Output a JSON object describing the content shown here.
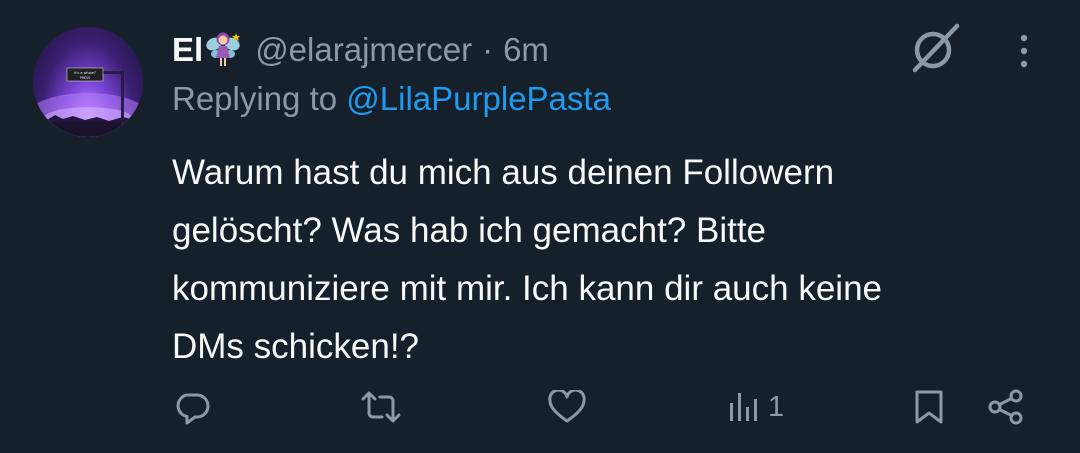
{
  "tweet": {
    "display_name": "El",
    "name_emoji": "fairy-emoji",
    "handle": "@elarajmercer",
    "separator": "·",
    "time": "6m",
    "replying_prefix": "Replying to",
    "replying_to": "@LilaPurplePasta",
    "text_lines": [
      "Warum hast du mich aus deinen Followern",
      "gelöscht? Was hab ich gemacht? Bitte",
      "kommuniziere mit mir. Ich kann dir auch keine",
      "DMs schicken!?"
    ],
    "avatar_sign_text": "it's a whole? PRESS"
  },
  "actions": {
    "reply_icon": "reply-icon",
    "retweet_icon": "retweet-icon",
    "like_icon": "heart-icon",
    "views_icon": "views-icon",
    "views_count": "1",
    "bookmark_icon": "bookmark-icon",
    "share_icon": "share-icon"
  },
  "colors": {
    "background": "#15202b",
    "text": "#f7f9f9",
    "secondary": "#8b98a5",
    "link": "#1d9bf0"
  }
}
